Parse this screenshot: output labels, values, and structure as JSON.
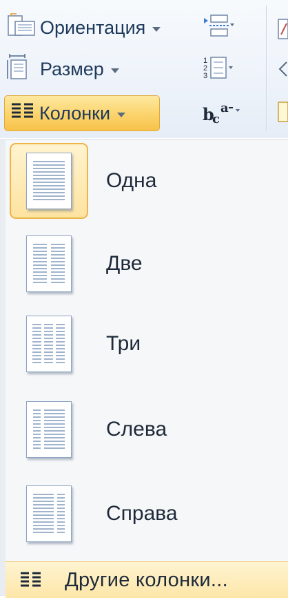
{
  "ribbon": {
    "orientation_label": "Ориентация",
    "size_label": "Размер",
    "columns_label": "Колонки",
    "hyphenation_glyph": "bca-"
  },
  "columns_menu": {
    "items": [
      {
        "label": "Одна",
        "selected": true
      },
      {
        "label": "Две"
      },
      {
        "label": "Три"
      },
      {
        "label": "Слева"
      },
      {
        "label": "Справа"
      }
    ],
    "more_label": "Другие колонки..."
  },
  "colors": {
    "active_fill": "#fbd36c",
    "active_border": "#e0a93c",
    "text": "#1e395b"
  }
}
